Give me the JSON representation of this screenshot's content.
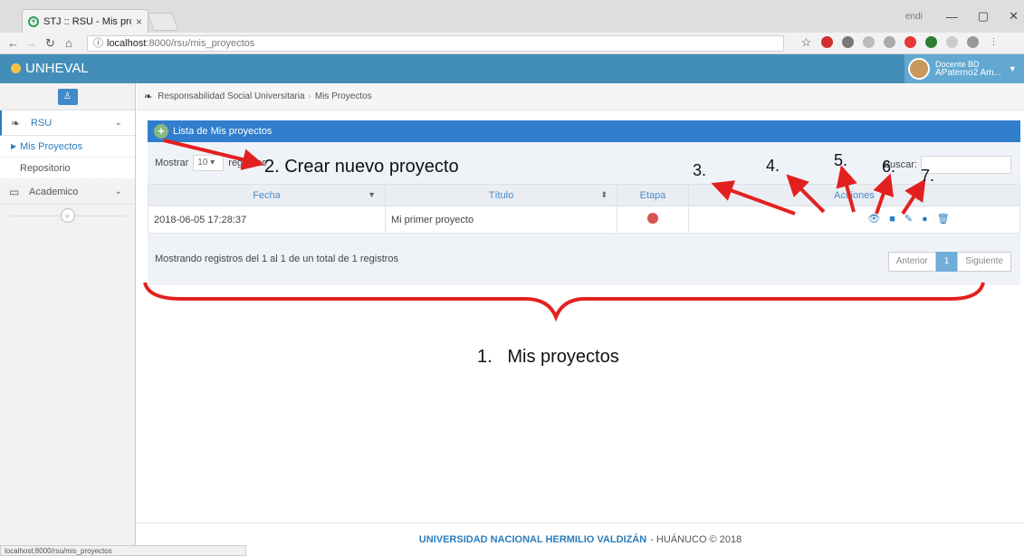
{
  "browser": {
    "tab_title": "STJ :: RSU - Mis proyecto",
    "tab_close": "×",
    "window_user": "endi",
    "url_host": "localhost",
    "url_path": ":8000/rsu/mis_proyectos",
    "status_url": "localhost:8000/rsu/mis_proyectos"
  },
  "app": {
    "brand": "UNHEVAL",
    "user_role": "Docente BD",
    "user_name": "APaterno2 Am..."
  },
  "sidebar": {
    "items": [
      {
        "label": "RSU",
        "icon": "leaf-icon"
      },
      {
        "label": "Academico",
        "icon": "monitor-icon"
      }
    ],
    "subitems": [
      {
        "label": "Mis Proyectos"
      },
      {
        "label": "Repositorio"
      }
    ],
    "collapse_glyph": "«"
  },
  "breadcrumb": {
    "root": "Responsabilidad Social Universitaria",
    "current": "Mis Proyectos"
  },
  "panel": {
    "title": "Lista de Mis proyectos",
    "show_label": "Mostrar",
    "page_size": "10",
    "records_label": "registros",
    "search_label": "Buscar:",
    "columns": [
      "Fecha",
      "Título",
      "Etapa",
      "Acciones"
    ],
    "rows": [
      {
        "fecha": "2018-06-05 17:28:37",
        "titulo": "Mi primer proyecto",
        "etapa_color": "#d9534f"
      }
    ],
    "action_icons": [
      "eye-icon",
      "folder-icon",
      "edit-icon",
      "comment-icon",
      "trash-icon"
    ],
    "info": "Mostrando registros del 1 al 1 de un total de 1 registros",
    "pager": {
      "prev": "Anterior",
      "page": "1",
      "next": "Siguiente"
    }
  },
  "footer": {
    "university": "UNIVERSIDAD NACIONAL HERMILIO VALDIZÁN",
    "rest": "- HUÁNUCO © 2018"
  },
  "annotations": {
    "n1": "1.   Mis proyectos",
    "n2": "2. Crear nuevo proyecto",
    "n3": "3.",
    "n4": "4.",
    "n5": "5.",
    "n6": "6.",
    "n7": "7."
  },
  "colors": {
    "header": "#438eb9",
    "panel_head": "#307ecc",
    "arrow": "#e32020"
  }
}
